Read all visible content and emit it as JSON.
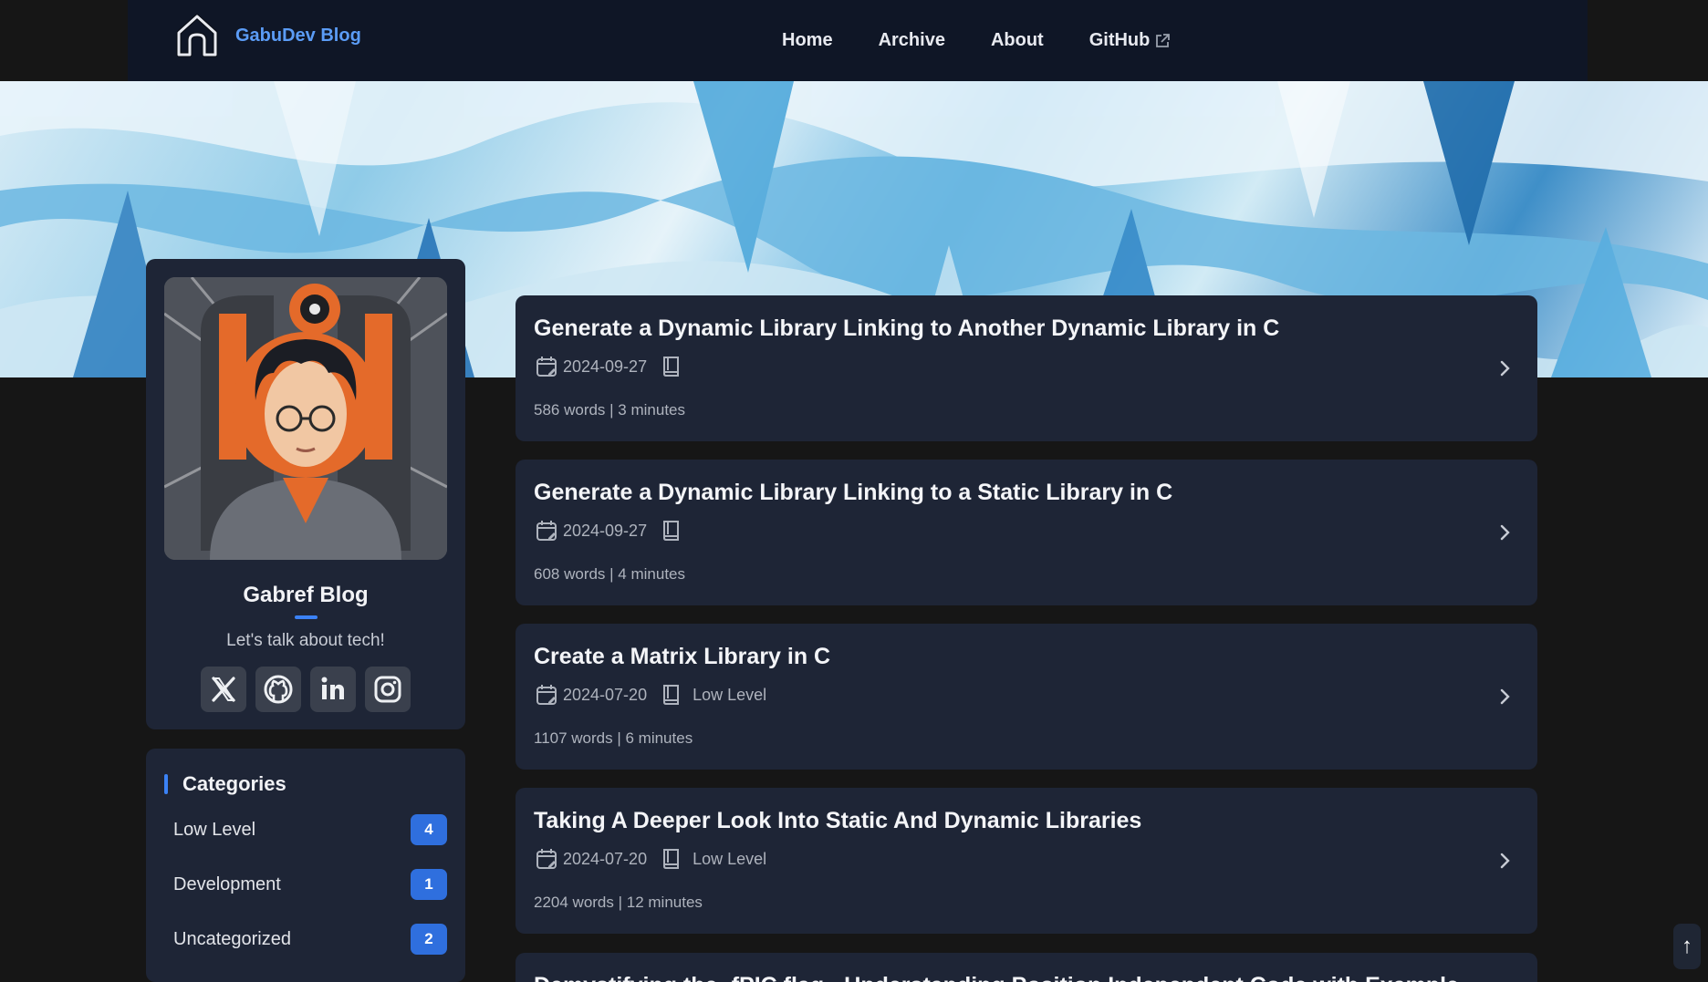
{
  "nav": {
    "brand": "GabuDev Blog",
    "links": [
      "Home",
      "Archive",
      "About",
      "GitHub"
    ]
  },
  "profile": {
    "name": "Gabref Blog",
    "tagline": "Let's talk about tech!",
    "socials": [
      "x-icon",
      "github-icon",
      "linkedin-icon",
      "instagram-icon"
    ]
  },
  "categories": {
    "title": "Categories",
    "items": [
      {
        "label": "Low Level",
        "count": "4"
      },
      {
        "label": "Development",
        "count": "1"
      },
      {
        "label": "Uncategorized",
        "count": "2"
      }
    ]
  },
  "posts": [
    {
      "title": "Generate a Dynamic Library Linking to Another Dynamic Library in C",
      "date": "2024-09-27",
      "category": "",
      "stats": "586 words | 3 minutes"
    },
    {
      "title": "Generate a Dynamic Library Linking to a Static Library in C",
      "date": "2024-09-27",
      "category": "",
      "stats": "608 words | 4 minutes"
    },
    {
      "title": "Create a Matrix Library in C",
      "date": "2024-07-20",
      "category": "Low Level",
      "stats": "1107 words | 6 minutes"
    },
    {
      "title": "Taking A Deeper Look Into Static And Dynamic Libraries",
      "date": "2024-07-20",
      "category": "Low Level",
      "stats": "2204 words | 12 minutes"
    },
    {
      "title": "Demystifying the -fPIC flag - Understanding Position Independent Code with Example"
    }
  ],
  "back_to_top": "↑",
  "colors": {
    "accent": "#3b82f6",
    "brand": "#5b9cf6",
    "card": "#1e2536",
    "nav": "#0f1626",
    "page": "#161616"
  }
}
